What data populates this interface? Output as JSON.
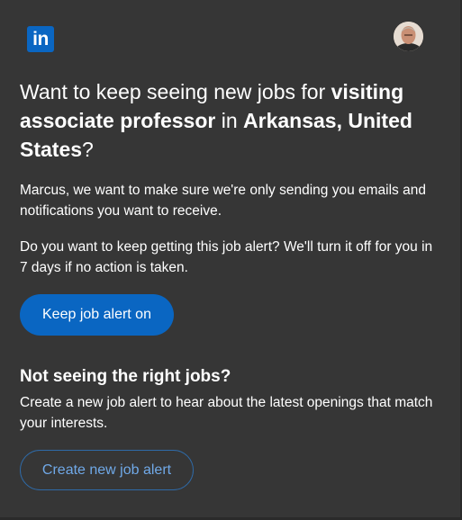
{
  "header": {
    "logo_text": "in",
    "logo_icon": "linkedin-logo-icon",
    "avatar_icon": "user-avatar-icon"
  },
  "headline": {
    "part1": "Want to keep seeing new jobs for ",
    "job_title": "visiting associate professor",
    "part2": " in ",
    "location": "Arkansas, United States",
    "part3": "?"
  },
  "body": {
    "para1": "Marcus, we want to make sure we're only sending you emails and notifications you want to receive.",
    "para2": "Do you want to keep getting this job alert? We'll turn it off for you in 7 days if no action is taken."
  },
  "primary_button": {
    "label": "Keep job alert on"
  },
  "secondary_section": {
    "title": "Not seeing the right jobs?",
    "text": "Create a new job alert to hear about the latest openings that match your interests.",
    "button_label": "Create new job alert"
  },
  "colors": {
    "background": "#363636",
    "brand": "#0a66c2",
    "link": "#70a9e8"
  }
}
